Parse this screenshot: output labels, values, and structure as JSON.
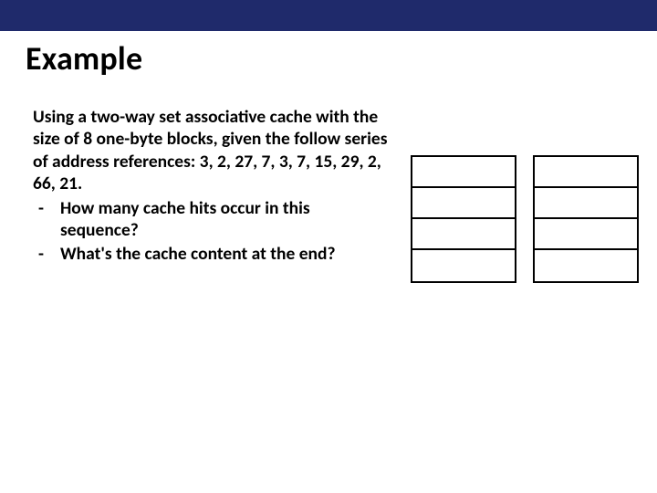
{
  "colors": {
    "bar": "#1f2a6b"
  },
  "title": "Example",
  "intro": "Using a two-way set associative cache with the size of 8 one-byte blocks, given the follow series of address references: 3, 2, 27, 7, 3, 7, 15, 29, 2, 66, 21.",
  "questions": [
    "How many cache hits occur in this sequence?",
    "What's the cache content at the end?"
  ],
  "cache_tables": {
    "ways": 2,
    "sets_per_way": 4,
    "cells": [
      [
        "",
        "",
        "",
        ""
      ],
      [
        "",
        "",
        "",
        ""
      ]
    ]
  }
}
